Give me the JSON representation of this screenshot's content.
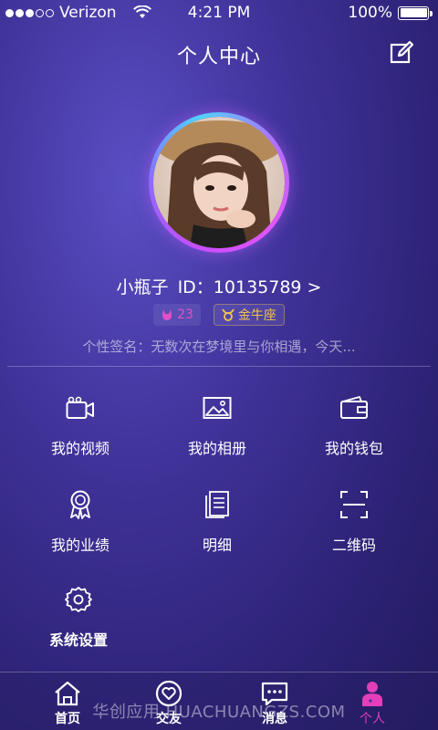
{
  "status_bar": {
    "carrier": "Verizon",
    "time": "4:21 PM",
    "battery": "100%"
  },
  "header": {
    "title": "个人中心",
    "edit_icon": "edit-icon"
  },
  "profile": {
    "name": "小瓶子",
    "id_text": "ID：10135789 >",
    "level": "23",
    "zodiac": "金牛座",
    "signature": "个性签名：无数次在梦境里与你相遇，今天..."
  },
  "menu": [
    {
      "label": "我的视频",
      "icon": "video-camera-icon"
    },
    {
      "label": "我的相册",
      "icon": "photo-album-icon"
    },
    {
      "label": "我的钱包",
      "icon": "wallet-icon"
    },
    {
      "label": "我的业绩",
      "icon": "award-ribbon-icon"
    },
    {
      "label": "明细",
      "icon": "document-list-icon"
    },
    {
      "label": "二维码",
      "icon": "qr-scan-icon"
    },
    {
      "label": "系统设置",
      "icon": "gear-icon"
    }
  ],
  "tabbar": [
    {
      "label": "首页",
      "icon": "home-icon"
    },
    {
      "label": "交友",
      "icon": "heart-chat-icon"
    },
    {
      "label": "消息",
      "icon": "message-bubble-icon"
    },
    {
      "label": "个人",
      "icon": "person-icon"
    }
  ],
  "watermark": "华创应用 HUACHUANGZS.COM",
  "colors": {
    "accent": "#e23fb8",
    "zodiac": "#f0c64a",
    "background": "#3f3298"
  }
}
